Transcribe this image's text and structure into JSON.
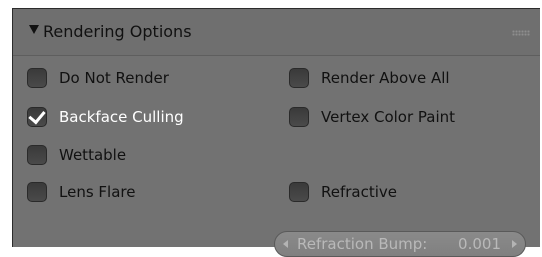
{
  "panel": {
    "title": "Rendering Options",
    "options": [
      {
        "label": "Do Not Render",
        "checked": false
      },
      {
        "label": "Render Above All",
        "checked": false
      },
      {
        "label": "Backface Culling",
        "checked": true
      },
      {
        "label": "Vertex Color Paint",
        "checked": false
      },
      {
        "label": "Wettable",
        "checked": false
      },
      {
        "label": "Lens Flare",
        "checked": false
      },
      {
        "label": "Refractive",
        "checked": false
      }
    ],
    "refraction_bump": {
      "label": "Refraction Bump:",
      "value": "0.001"
    }
  },
  "colors": {
    "panel_bg": "#727272",
    "text": "#111111",
    "checked_text": "#ffffff"
  }
}
